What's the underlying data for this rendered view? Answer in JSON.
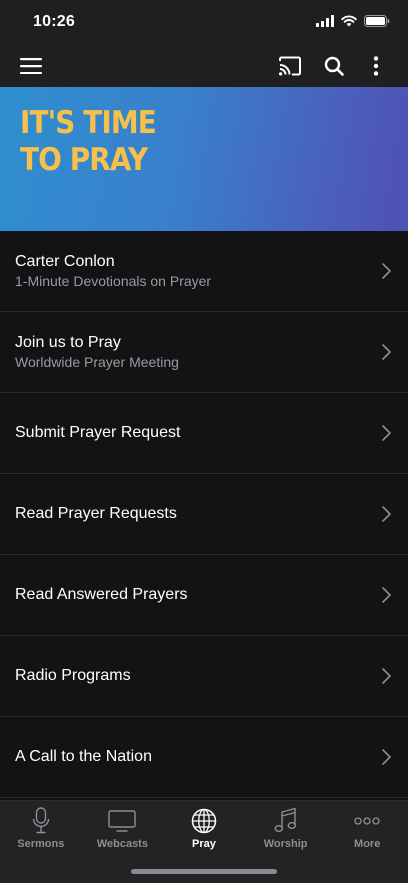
{
  "status_bar": {
    "time": "10:26"
  },
  "banner": {
    "line1": "IT'S TIME",
    "line2": "TO PRAY"
  },
  "menu": [
    {
      "title": "Carter Conlon",
      "subtitle": "1-Minute Devotionals on Prayer"
    },
    {
      "title": "Join us to Pray",
      "subtitle": "Worldwide Prayer Meeting"
    },
    {
      "title": "Submit Prayer Request"
    },
    {
      "title": "Read Prayer Requests"
    },
    {
      "title": "Read Answered Prayers"
    },
    {
      "title": "Radio Programs"
    },
    {
      "title": "A Call to the Nation"
    }
  ],
  "tabs": [
    {
      "label": "Sermons",
      "icon": "microphone-icon"
    },
    {
      "label": "Webcasts",
      "icon": "tv-icon"
    },
    {
      "label": "Pray",
      "icon": "globe-icon",
      "active": true
    },
    {
      "label": "Worship",
      "icon": "music-note-icon"
    },
    {
      "label": "More",
      "icon": "more-dots-icon"
    }
  ],
  "colors": {
    "banner_text": "#f7c04a",
    "background": "#131315",
    "tab_bar": "#232325"
  }
}
